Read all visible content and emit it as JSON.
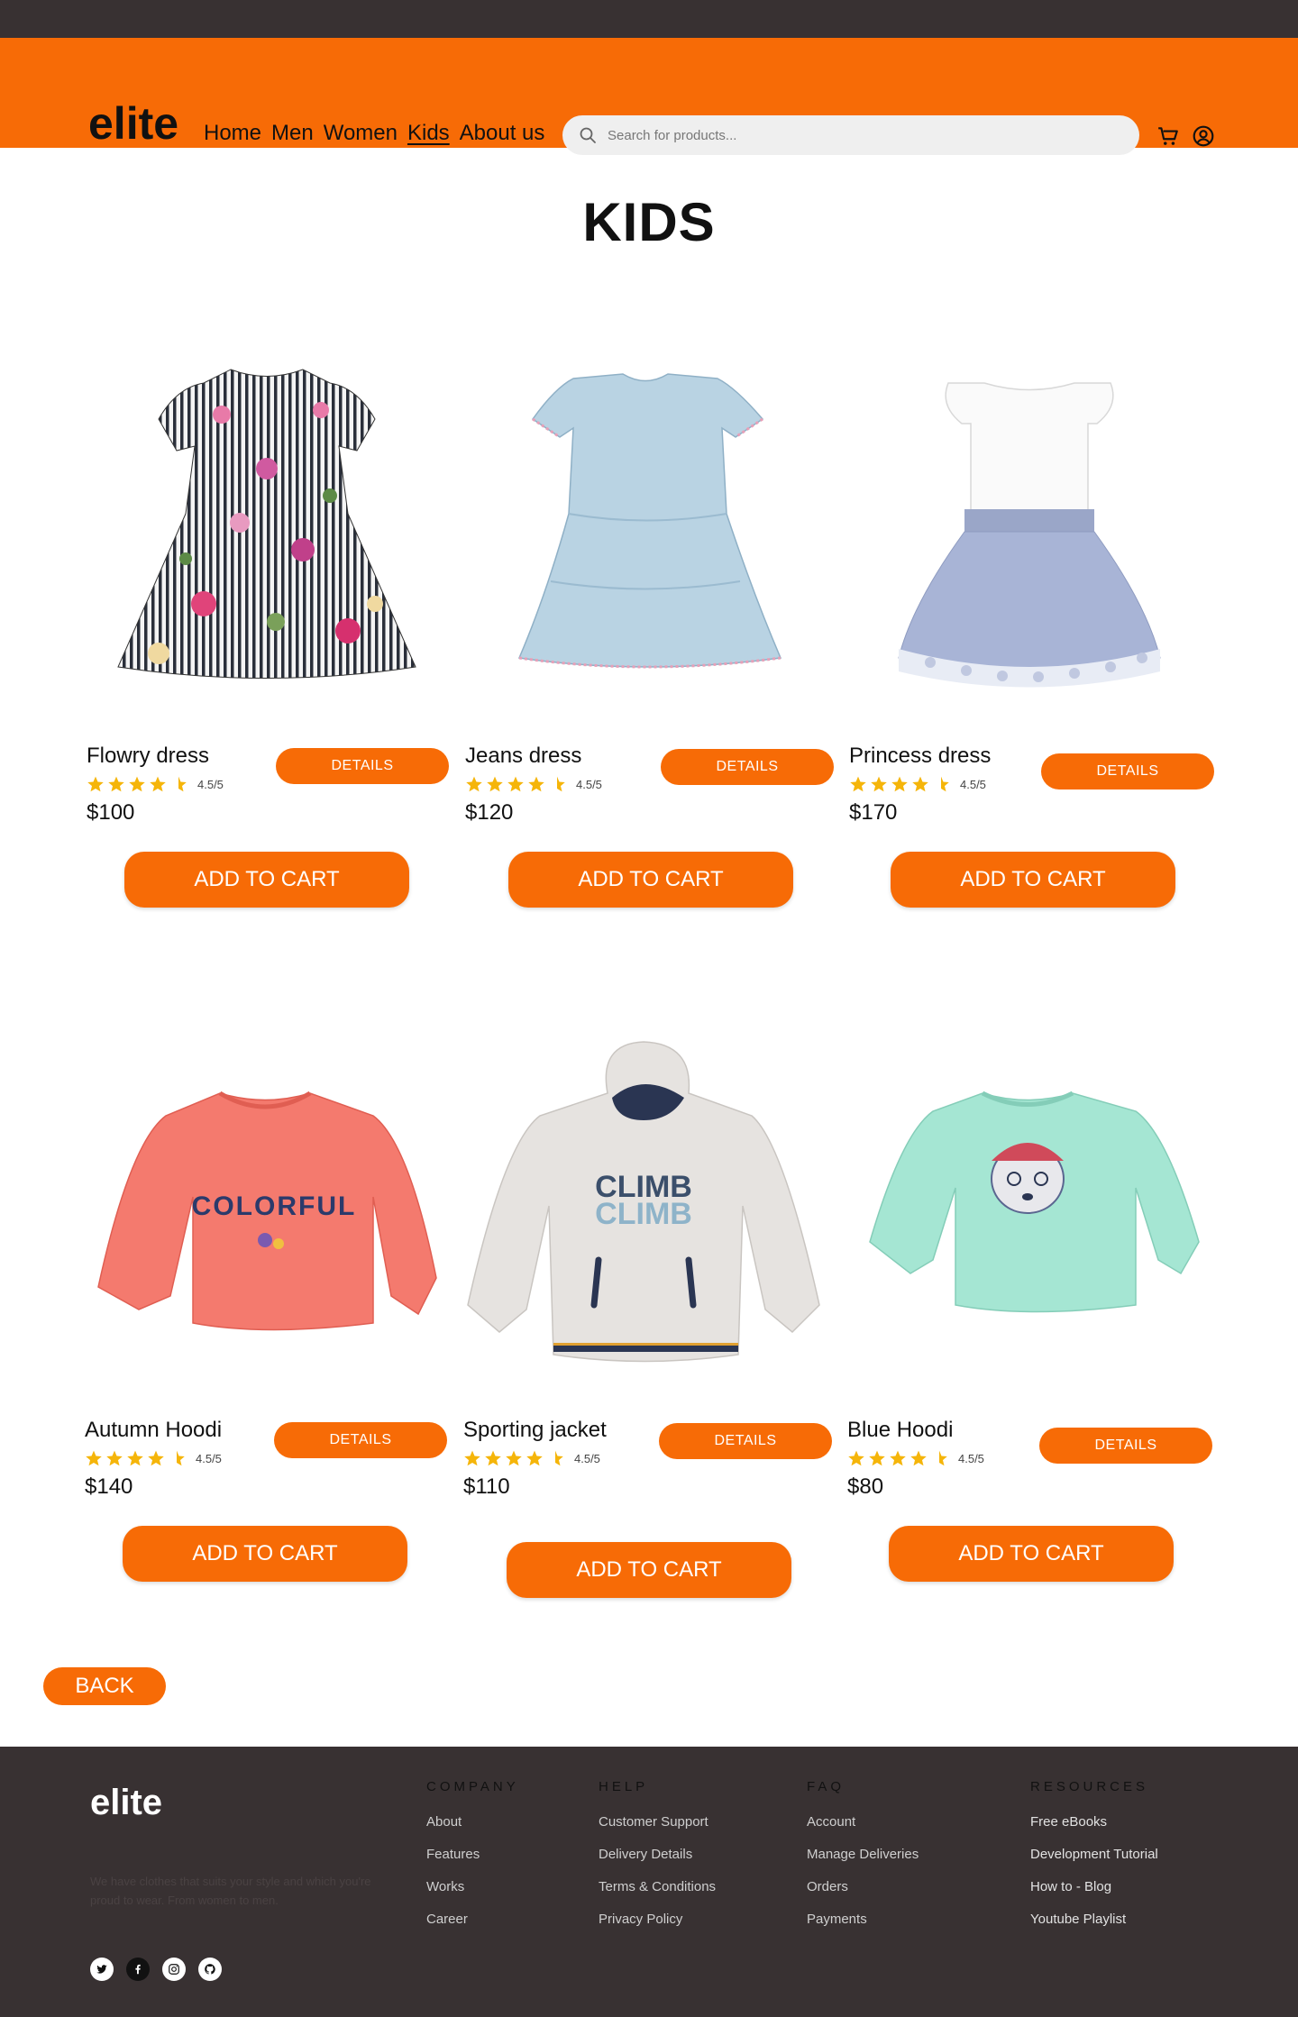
{
  "header": {
    "logo": "elite",
    "nav": [
      "Home",
      "Men",
      "Women",
      "Kids",
      "About us"
    ],
    "active_nav": "Kids",
    "search_placeholder": "Search for products..."
  },
  "page": {
    "title": "KIDS",
    "back_label": "BACK"
  },
  "products": [
    {
      "name": "Flowry dress",
      "rating": "4.5/5",
      "price": "$100",
      "details_label": "DETAILS",
      "cart_label": "ADD TO CART",
      "image": "floral-striped-dress"
    },
    {
      "name": "Jeans dress",
      "rating": "4.5/5",
      "price": "$120",
      "details_label": "DETAILS",
      "cart_label": "ADD TO CART",
      "image": "light-blue-denim-dress"
    },
    {
      "name": "Princess dress",
      "rating": "4.5/5",
      "price": "$170",
      "details_label": "DETAILS",
      "cart_label": "ADD TO CART",
      "image": "white-top-lace-skirt-dress"
    },
    {
      "name": "Autumn Hoodi",
      "rating": "4.5/5",
      "price": "$140",
      "details_label": "DETAILS",
      "cart_label": "ADD TO CART",
      "image": "coral-sweatshirt"
    },
    {
      "name": "Sporting jacket",
      "rating": "4.5/5",
      "price": "$110",
      "details_label": "DETAILS",
      "cart_label": "ADD TO CART",
      "image": "grey-climb-hoodie"
    },
    {
      "name": "Blue Hoodi",
      "rating": "4.5/5",
      "price": "$80",
      "details_label": "DETAILS",
      "cart_label": "ADD TO CART",
      "image": "mint-dog-sweatshirt"
    }
  ],
  "footer": {
    "logo": "elite",
    "tagline": "We have clothes that suits your style and which you're proud to wear. From women to men.",
    "columns": [
      {
        "title": "COMPANY",
        "links": [
          "About",
          "Features",
          "Works",
          "Career"
        ]
      },
      {
        "title": "HELP",
        "links": [
          "Customer Support",
          "Delivery Details",
          "Terms & Conditions",
          "Privacy Policy"
        ]
      },
      {
        "title": "FAQ",
        "links": [
          "Account",
          "Manage Deliveries",
          "Orders",
          "Payments"
        ]
      },
      {
        "title": "RESOURCES",
        "links": [
          "Free eBooks",
          "Development Tutorial",
          "How to - Blog",
          "Youtube Playlist"
        ]
      }
    ],
    "socials": [
      "twitter-icon",
      "facebook-icon",
      "instagram-icon",
      "github-icon"
    ]
  },
  "colors": {
    "accent": "#f76b06",
    "dark": "#383132",
    "star": "#f5b50a"
  }
}
